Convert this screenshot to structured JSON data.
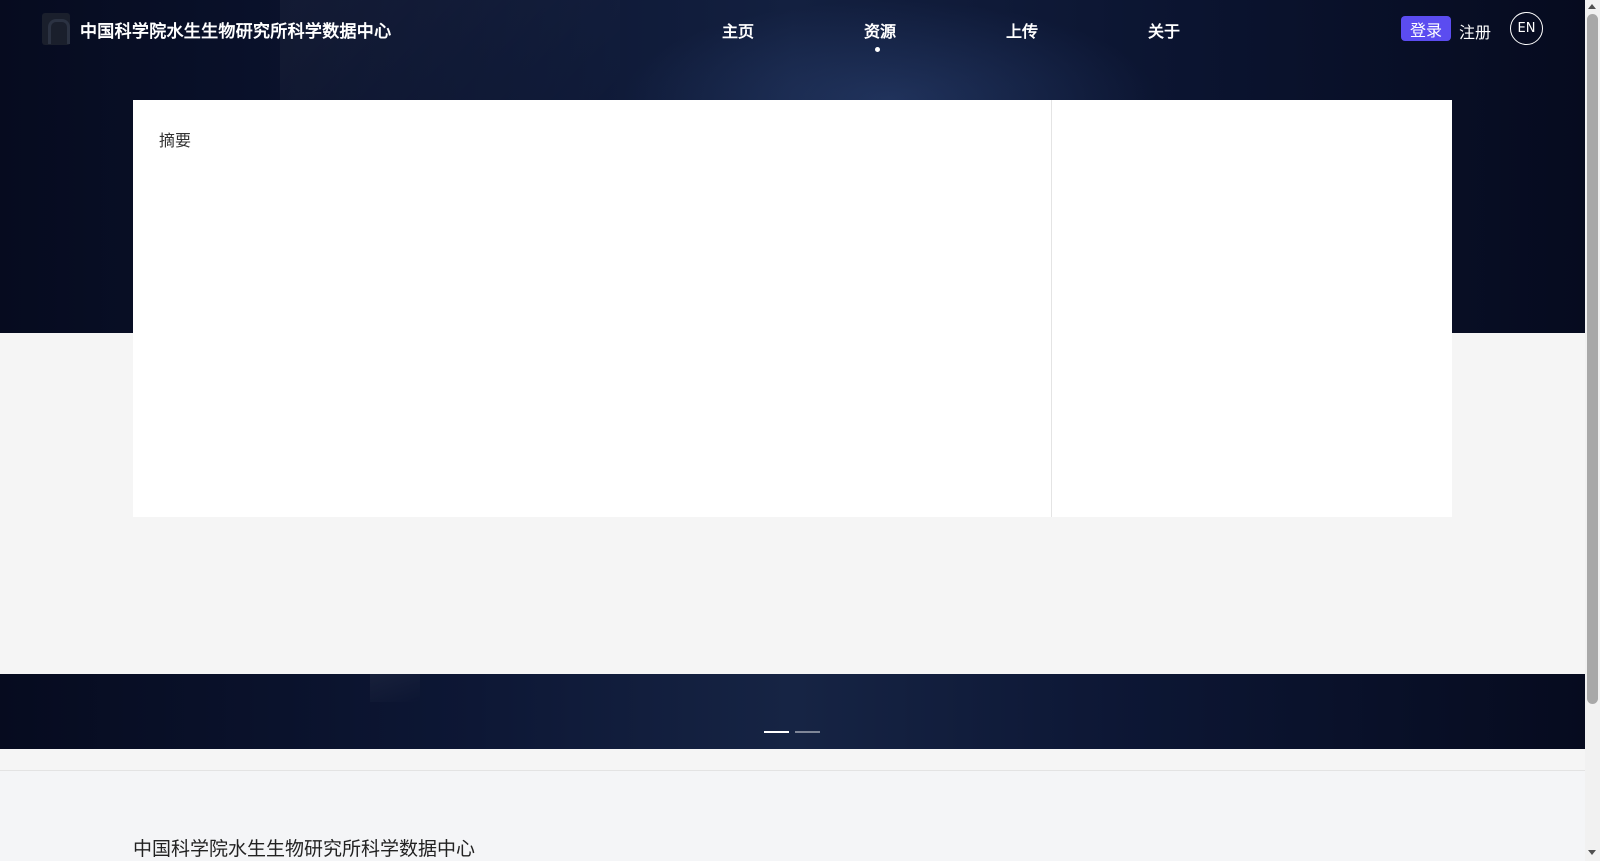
{
  "header": {
    "brand_title": "中国科学院水生生物研究所科学数据中心",
    "nav": [
      {
        "label": "主页"
      },
      {
        "label": "资源",
        "active": true
      },
      {
        "label": "上传"
      },
      {
        "label": "关于"
      }
    ],
    "login_label": "登录",
    "register_label": "注册",
    "language_label": "EN"
  },
  "main": {
    "abstract_label": "摘要"
  },
  "carousel": {
    "slide_count": 2,
    "active_index": 0
  },
  "footer": {
    "title": "中国科学院水生生物研究所科学数据中心"
  },
  "colors": {
    "accent": "#5b4cf0",
    "hero_dark": "#0b1430",
    "page_bg": "#f5f5f5"
  }
}
